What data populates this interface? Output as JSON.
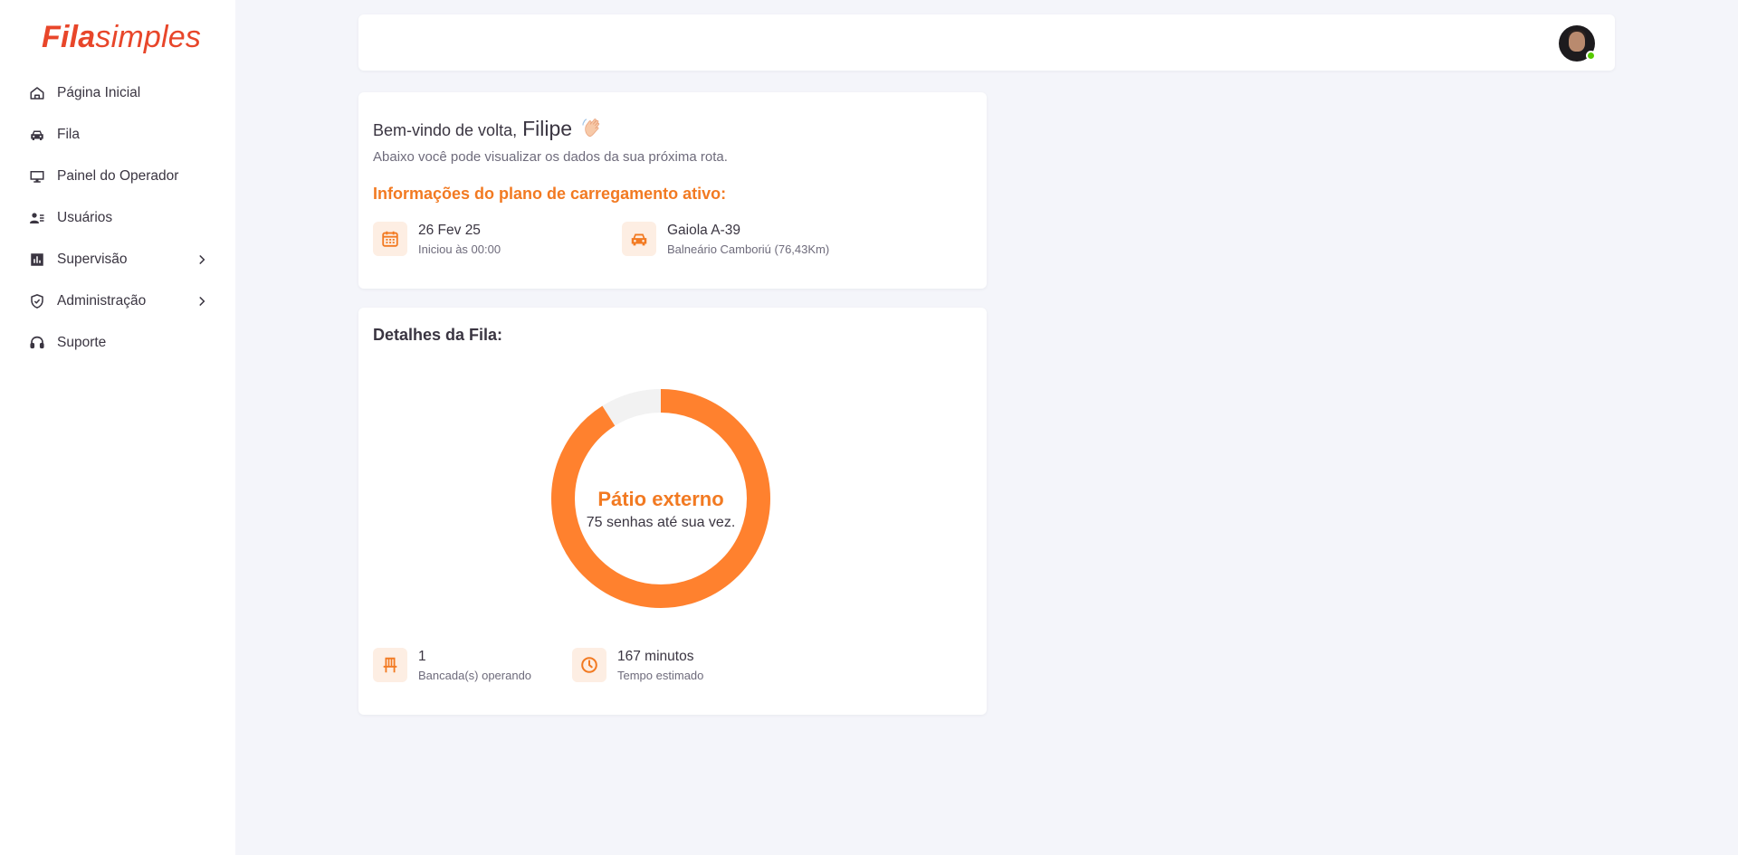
{
  "brand": {
    "name_bold": "Fila",
    "name_regular": "simples",
    "color": "#e8462a"
  },
  "accent_color": "#f27a22",
  "sidebar": {
    "items": [
      {
        "label": "Página Inicial",
        "icon": "home-icon",
        "has_submenu": false
      },
      {
        "label": "Fila",
        "icon": "car-icon",
        "has_submenu": false
      },
      {
        "label": "Painel do Operador",
        "icon": "monitor-icon",
        "has_submenu": false
      },
      {
        "label": "Usuários",
        "icon": "users-list-icon",
        "has_submenu": false
      },
      {
        "label": "Supervisão",
        "icon": "bar-chart-icon",
        "has_submenu": true
      },
      {
        "label": "Administração",
        "icon": "shield-check-icon",
        "has_submenu": true
      },
      {
        "label": "Suporte",
        "icon": "headset-icon",
        "has_submenu": false
      }
    ]
  },
  "topbar": {
    "avatar": "user-avatar",
    "status": "online"
  },
  "welcome": {
    "greeting": "Bem-vindo de volta,",
    "name": "Filipe",
    "emoji_icon": "waving-hand-icon",
    "subtitle": "Abaixo você pode visualizar os dados da sua próxima rota.",
    "plan_title": "Informações do plano de carregamento ativo:",
    "date": {
      "main": "26 Fev 25",
      "sub": "Iniciou às 00:00",
      "icon": "calendar-icon"
    },
    "route": {
      "main": "Gaiola A-39",
      "sub": "Balneário Camboriú (76,43Km)",
      "icon": "car-icon"
    }
  },
  "queue": {
    "title": "Detalhes da Fila:",
    "location": "Pátio externo",
    "remaining_text": "75 senhas até sua vez.",
    "progress_fraction": 0.91,
    "stations": {
      "main": "1",
      "sub": "Bancada(s) operando",
      "icon": "chair-icon"
    },
    "time": {
      "main": "167 minutos",
      "sub": "Tempo estimado",
      "icon": "clock-icon"
    }
  }
}
